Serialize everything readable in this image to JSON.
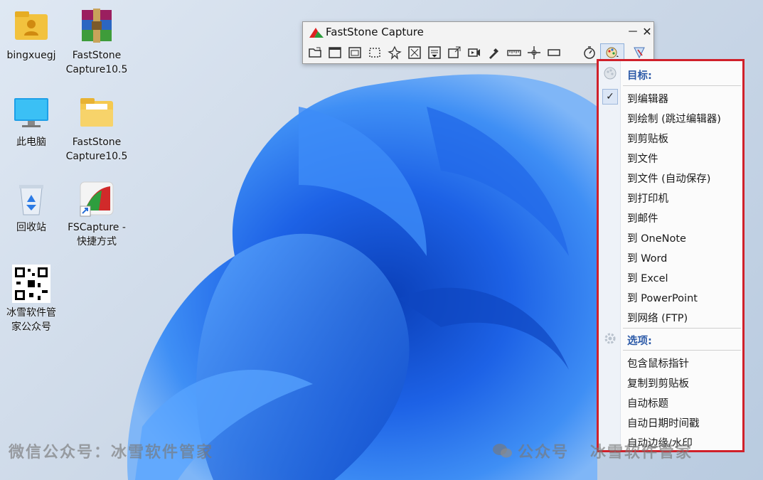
{
  "desktop_icons": [
    {
      "label": "bingxuegj",
      "icon": "user-folder-icon"
    },
    {
      "label": "FastStone\nCapture10.5",
      "icon": "winrar-archive-icon"
    },
    {
      "label": "此电脑",
      "icon": "monitor-icon"
    },
    {
      "label": "FastStone\nCapture10.5",
      "icon": "folder-icon"
    },
    {
      "label": "回收站",
      "icon": "recycle-bin-icon"
    },
    {
      "label": "FSCapture -\n快捷方式",
      "icon": "fscapture-shortcut-icon"
    },
    {
      "label": "冰雪软件管\n家公众号",
      "icon": "qr-code-icon"
    }
  ],
  "window": {
    "title": "FastStone Capture",
    "minimize": "－",
    "close": "✕"
  },
  "toolbar": [
    "open-icon",
    "capture-window-icon",
    "capture-object-icon",
    "capture-rectangle-icon",
    "capture-freehand-icon",
    "capture-fullscreen-icon",
    "scrolling-capture-icon",
    "fixed-region-icon",
    "screen-recorder-icon",
    "color-picker-icon",
    "ruler-icon",
    "crosshair-icon",
    "magnifier-icon",
    "timer-icon",
    "output-destination-icon",
    "settings-icon"
  ],
  "menu": {
    "target_header": "目标:",
    "targets": [
      "到编辑器",
      "到绘制 (跳过编辑器)",
      "到剪贴板",
      "到文件",
      "到文件 (自动保存)",
      "到打印机",
      "到邮件",
      "到 OneNote",
      "到 Word",
      "到 Excel",
      "到 PowerPoint",
      "到网络 (FTP)"
    ],
    "checked_index": 0,
    "options_header": "选项:",
    "options": [
      "包含鼠标指针",
      "复制到剪贴板",
      "自动标题",
      "自动日期时间戳",
      "自动边缘/水印"
    ]
  },
  "watermarks": {
    "left": "微信公众号：冰雪软件管家",
    "right_prefix": "公众号",
    "right": "冰雪软件管家"
  },
  "colors": {
    "menu_border": "#d0202a",
    "menu_header": "#2c5aa8",
    "wallpaper_blue": "#1a5fe0"
  }
}
